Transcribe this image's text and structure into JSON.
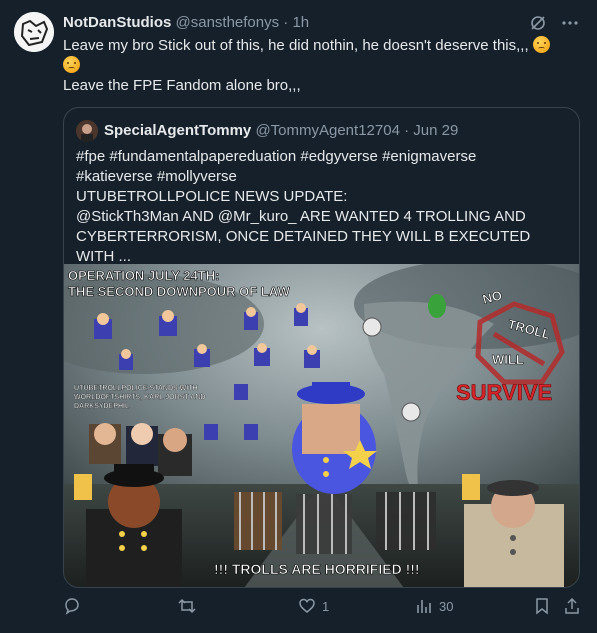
{
  "post": {
    "author": {
      "name": "NotDanStudios",
      "handle": "@sansthefonys",
      "time": "1h"
    },
    "text_line1": "Leave my bro Stick out of this, he did nothin, he doesn't deserve this,,,",
    "text_line2": "Leave the FPE Fandom alone bro,,,"
  },
  "quote": {
    "author": {
      "name": "SpecialAgentTommy",
      "handle": "@TommyAgent12704",
      "date": "Jun 29"
    },
    "hashtags_line1": "#fpe #fundamentalpapereduation #edgyverse #enigmaverse",
    "hashtags_line2": "#katieverse #mollyverse",
    "line3": "UTUBETROLLPOLICE NEWS UPDATE:",
    "line4": "@StickTh3Man AND @Mr_kuro_ ARE WANTED 4 TROLLING AND",
    "line5": "CYBERTERRORISM, ONCE DETAINED THEY WILL B EXECUTED WITH ...",
    "media": {
      "title_line1": "OPERATION JULY 24TH:",
      "title_line2": "THE SECOND DOWNPOUR OF LAW",
      "stands_with": "UTUBETROLLPOLICE STANDS WITH\nWORLDOFTSHIRTS, KARL JOBST AND\nDARKSYDEPHIL",
      "badge_words": [
        "NO",
        "TROLL",
        "WILL"
      ],
      "survive": "SURVIVE",
      "bottom_caption": "!!! TROLLS ARE HORRIFIED !!!"
    }
  },
  "actions": {
    "reply_count": "",
    "repost_count": "",
    "like_count": "1",
    "views_count": "30"
  }
}
